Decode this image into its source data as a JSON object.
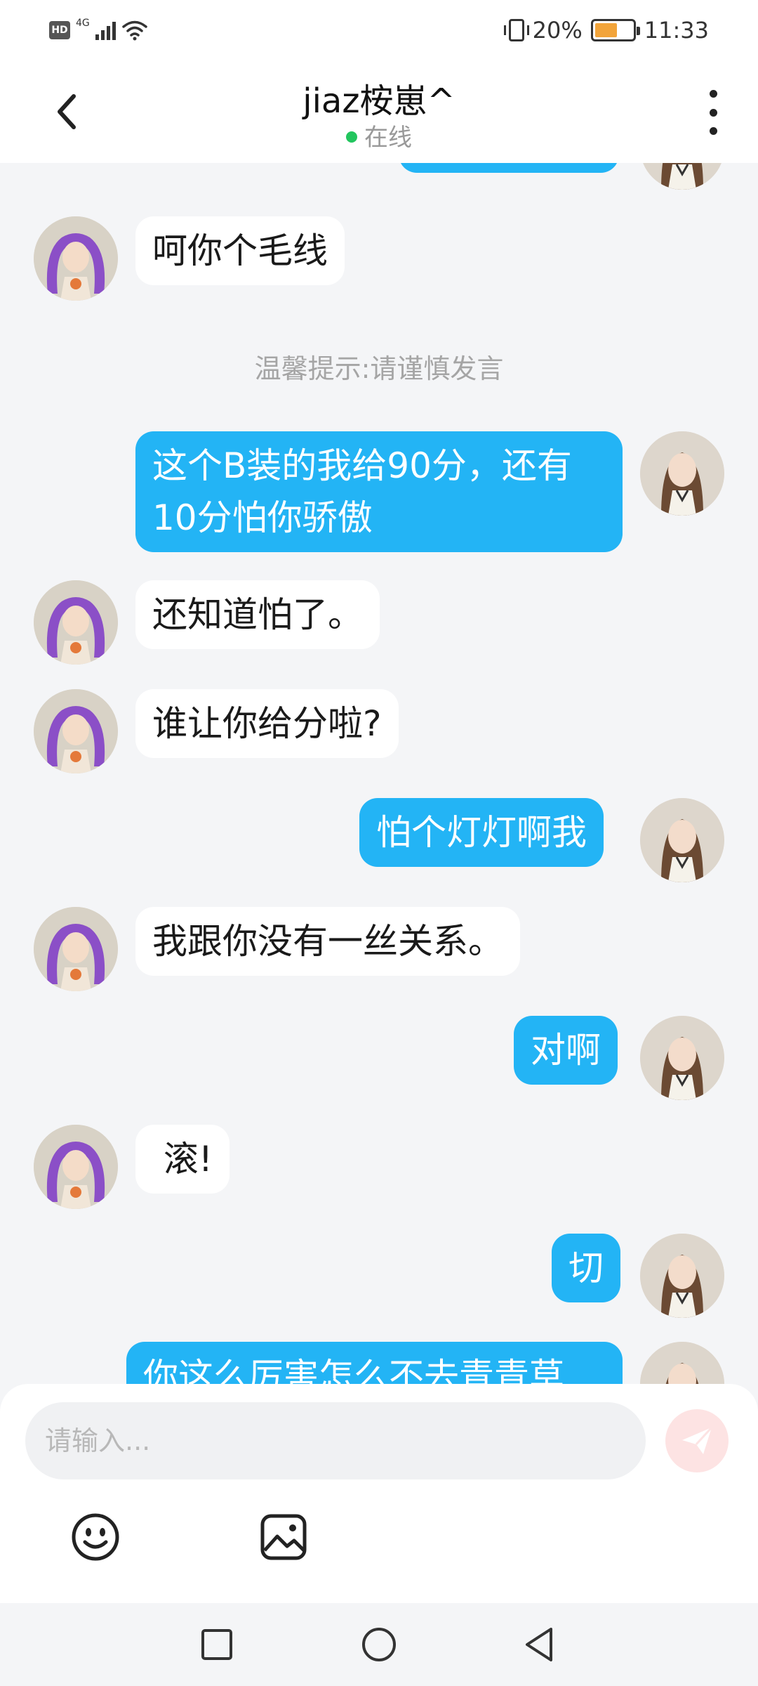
{
  "status_bar": {
    "hd": "HD",
    "network": "4G",
    "battery_percent": "20%",
    "time": "11:33"
  },
  "header": {
    "contact_name": "jiaz桉崽^",
    "status_text": "在线"
  },
  "chat": {
    "notice": "温馨提示:请谨慎发言",
    "messages": [
      {
        "from": "me",
        "text": ""
      },
      {
        "from": "them",
        "text": "呵你个毛线"
      },
      {
        "from": "me",
        "lines": [
          "这个B装的我给90分，还有",
          "10分怕你骄傲"
        ]
      },
      {
        "from": "them",
        "text": "还知道怕了。"
      },
      {
        "from": "them",
        "text": "谁让你给分啦?"
      },
      {
        "from": "me",
        "text": "怕个灯灯啊我"
      },
      {
        "from": "them",
        "text": "我跟你没有一丝关系。"
      },
      {
        "from": "me",
        "text": "对啊"
      },
      {
        "from": "them",
        "text": " 滚!"
      },
      {
        "from": "me",
        "text": "切"
      },
      {
        "from": "me",
        "text": "你这么厉害怎么不去青青草"
      }
    ]
  },
  "input_panel": {
    "placeholder": "请输入..."
  },
  "icons": {
    "back": "chevron-left-icon",
    "more": "more-vertical-icon",
    "send": "send-icon",
    "emoji": "emoji-icon",
    "image": "image-icon",
    "nav_recent": "square-icon",
    "nav_home": "circle-icon",
    "nav_back": "triangle-back-icon"
  },
  "colors": {
    "my_bubble": "#23b4f5",
    "their_bubble": "#ffffff",
    "online_dot": "#22c55e",
    "send_button_bg": "#fde3e3"
  }
}
